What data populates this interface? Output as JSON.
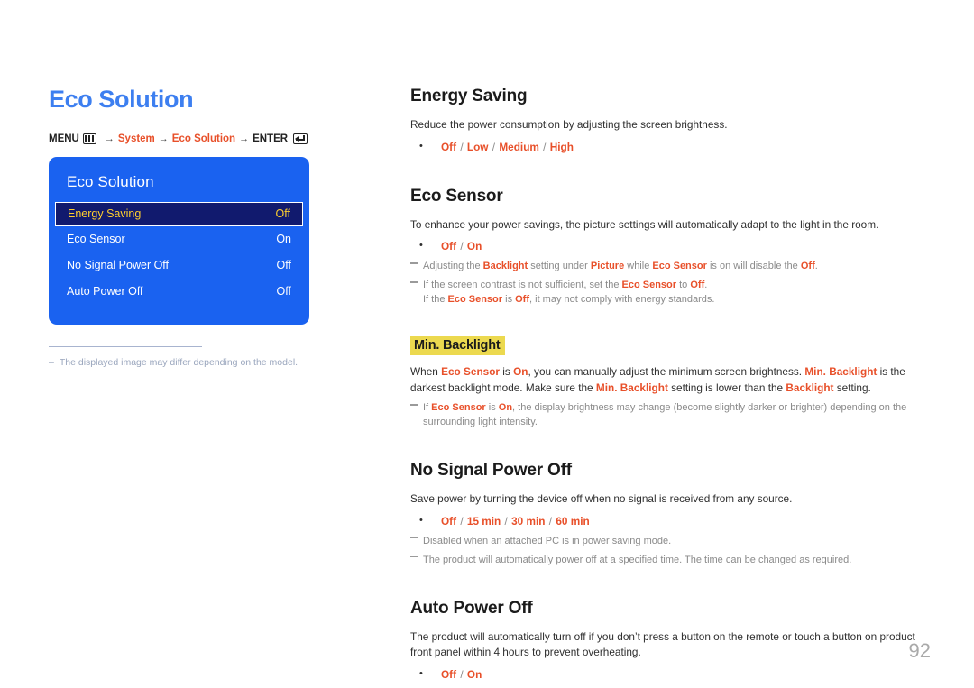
{
  "page": {
    "title": "Eco Solution",
    "number": "92"
  },
  "breadcrumb": {
    "menu_label": "MENU",
    "menu_icon": "menu-grid-icon",
    "arrow": "→",
    "segments": [
      "System",
      "Eco Solution"
    ],
    "enter_label": "ENTER",
    "enter_icon": "enter-return-icon"
  },
  "osd": {
    "title": "Eco Solution",
    "rows": [
      {
        "label": "Energy Saving",
        "value": "Off",
        "selected": true
      },
      {
        "label": "Eco Sensor",
        "value": "On",
        "selected": false
      },
      {
        "label": "No Signal Power Off",
        "value": "Off",
        "selected": false
      },
      {
        "label": "Auto Power Off",
        "value": "Off",
        "selected": false
      }
    ],
    "note": {
      "dash": "–",
      "text": "The displayed image may differ depending on the model."
    }
  },
  "colors": {
    "title_blue": "#3d7ff0",
    "osd_blue": "#1a62f0",
    "osd_selected_bg": "#111a6e",
    "osd_selected_text": "#ffcf2e",
    "accent_orange": "#e8502a",
    "highlight_yellow": "#ecd94f",
    "note_gray": "#8a8a8a",
    "page_number_gray": "#a9a9a9"
  },
  "sections": {
    "energy_saving": {
      "heading": "Energy Saving",
      "body": "Reduce the power consumption by adjusting the screen brightness.",
      "options": [
        "Off",
        "Low",
        "Medium",
        "High"
      ]
    },
    "eco_sensor": {
      "heading": "Eco Sensor",
      "body": "To enhance your power savings, the picture settings will automatically adapt to the light in the room.",
      "options": [
        "Off",
        "On"
      ],
      "note1_a": "Adjusting the ",
      "note1_kw1": "Backlight",
      "note1_b": " setting under ",
      "note1_kw2": "Picture",
      "note1_c": " while ",
      "note1_kw3": "Eco Sensor",
      "note1_d": " is on will disable the ",
      "note1_kw4": "Off",
      "note1_e": ".",
      "note2_a": "If the screen contrast is not sufficient, set the ",
      "note2_kw1": "Eco Sensor",
      "note2_b": " to ",
      "note2_kw2": "Off",
      "note2_c": ".",
      "note2_line2_a": "If the ",
      "note2_line2_kw1": "Eco Sensor",
      "note2_line2_b": " is ",
      "note2_line2_kw2": "Off",
      "note2_line2_c": ", it may not comply with energy standards."
    },
    "min_backlight": {
      "heading": "Min. Backlight",
      "body_a": "When ",
      "body_kw1": "Eco Sensor",
      "body_b": " is ",
      "body_kw2": "On",
      "body_c": ", you can manually adjust the minimum screen brightness. ",
      "body_kw3": "Min. Backlight",
      "body_d": " is the darkest backlight mode. Make sure the ",
      "body_kw4": "Min. Backlight",
      "body_e": " setting is lower than the ",
      "body_kw5": "Backlight",
      "body_f": " setting.",
      "note_a": "If ",
      "note_kw1": "Eco Sensor",
      "note_b": " is ",
      "note_kw2": "On",
      "note_c": ", the display brightness may change (become slightly darker or brighter) depending on the",
      "note_line2": "surrounding light intensity."
    },
    "no_signal_power_off": {
      "heading": "No Signal Power Off",
      "body": "Save power by turning the device off when no signal is received from any source.",
      "options": [
        "Off",
        "15 min",
        "30 min",
        "60 min"
      ],
      "note1": "Disabled when an attached PC is in power saving mode.",
      "note2": "The product will automatically power off at a specified time. The time can be changed as required."
    },
    "auto_power_off": {
      "heading": "Auto Power Off",
      "body": "The product will automatically turn off if you don’t press a button on the remote or touch a button on product front panel within 4 hours to prevent overheating.",
      "options": [
        "Off",
        "On"
      ]
    }
  }
}
